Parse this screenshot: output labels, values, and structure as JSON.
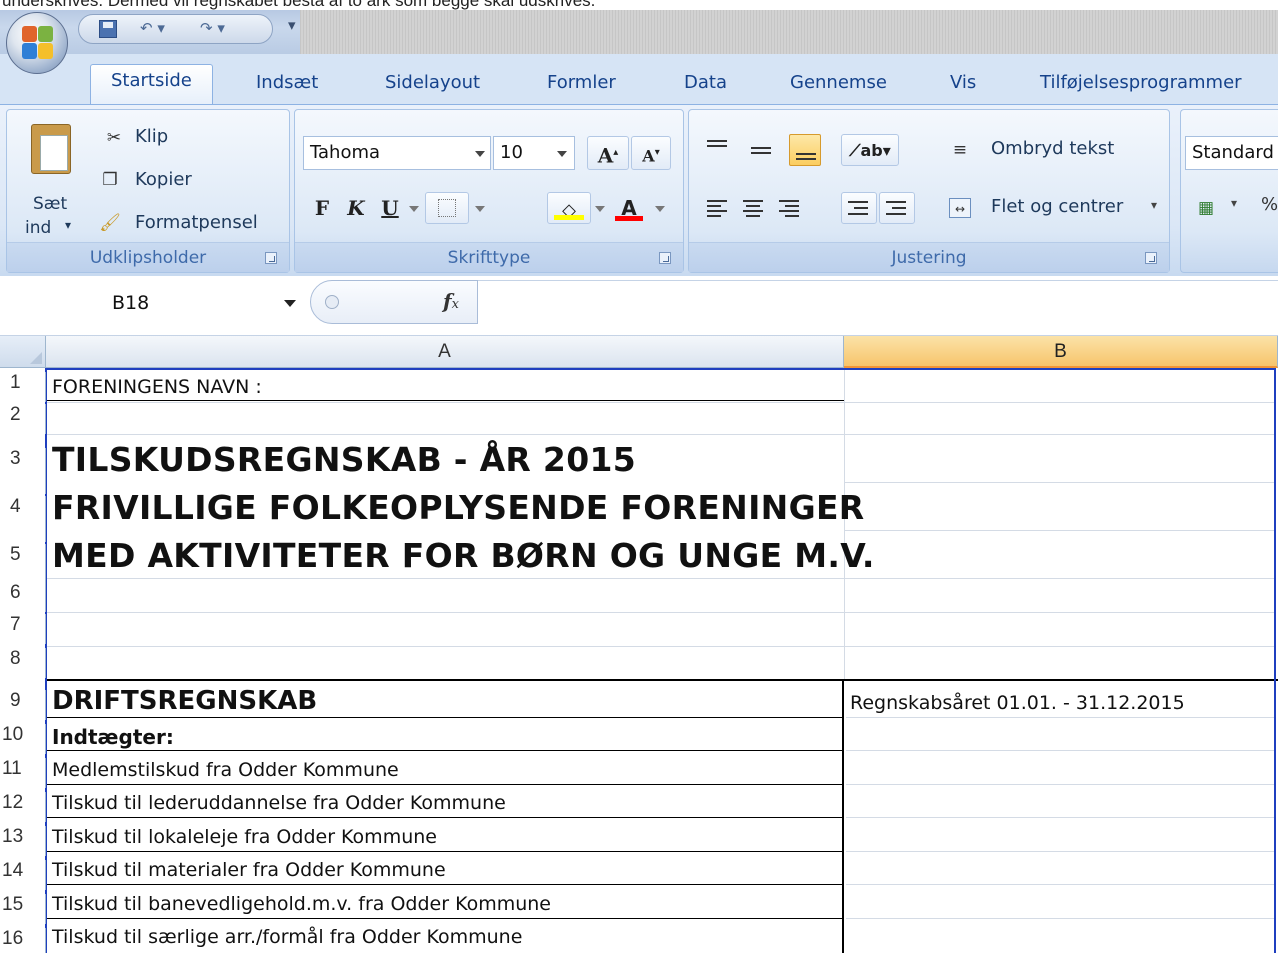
{
  "caption": {
    "text": "underskrives. Dermed vil regnskabet bestå af to ark som begge skal udskrives."
  },
  "tabs": [
    "Startside",
    "Indsæt",
    "Sidelayout",
    "Formler",
    "Data",
    "Gennemse",
    "Vis",
    "Tilføjelsesprogrammer"
  ],
  "ribbon": {
    "clipboard": {
      "paste_label_1": "Sæt",
      "paste_label_2": "ind",
      "cut": "Klip",
      "copy": "Kopier",
      "format_painter": "Formatpensel",
      "group_label": "Udklipsholder"
    },
    "font": {
      "font_name": "Tahoma",
      "font_size": "10",
      "bold": "F",
      "italic": "K",
      "underline": "U",
      "group_label": "Skrifttype"
    },
    "alignment": {
      "wrap_text": "Ombryd tekst",
      "merge_center": "Flet og centrer",
      "group_label": "Justering"
    },
    "number": {
      "format": "Standard"
    }
  },
  "formula_bar": {
    "name_box": "B18",
    "fx": "fx",
    "value": ""
  },
  "columns": [
    "A",
    "B"
  ],
  "rows": [
    {
      "num": "1",
      "a": "FORENINGENS NAVN :",
      "b": ""
    },
    {
      "num": "2",
      "a": "",
      "b": ""
    },
    {
      "num": "3",
      "a": "TILSKUDSREGNSKAB  -  ÅR 2015",
      "b": ""
    },
    {
      "num": "4",
      "a": "FRIVILLIGE FOLKEOPLYSENDE FORENINGER",
      "b": ""
    },
    {
      "num": "5",
      "a": "MED AKTIVITETER FOR BØRN OG UNGE M.V.",
      "b": ""
    },
    {
      "num": "6",
      "a": "",
      "b": ""
    },
    {
      "num": "7",
      "a": "",
      "b": ""
    },
    {
      "num": "8",
      "a": "",
      "b": ""
    },
    {
      "num": "9",
      "a": "DRIFTSREGNSKAB",
      "b": "Regnskabsåret 01.01. - 31.12.2015"
    },
    {
      "num": "10",
      "a": "Indtægter:",
      "b": ""
    },
    {
      "num": "11",
      "a": "Medlemstilskud fra Odder Kommune",
      "b": ""
    },
    {
      "num": "12",
      "a": "Tilskud til lederuddannelse fra Odder Kommune",
      "b": ""
    },
    {
      "num": "13",
      "a": "Tilskud til lokaleleje fra Odder Kommune",
      "b": ""
    },
    {
      "num": "14",
      "a": "Tilskud til materialer fra Odder Kommune",
      "b": ""
    },
    {
      "num": "15",
      "a": "Tilskud til banevedligehold.m.v. fra Odder Kommune",
      "b": ""
    },
    {
      "num": "16",
      "a": "Tilskud til særlige arr./formål fra Odder Kommune",
      "b": ""
    }
  ],
  "colors": {
    "ribbon_text": "#15428b",
    "selected_column": "#f7c46c",
    "sheet_border": "#1f3fbf"
  }
}
